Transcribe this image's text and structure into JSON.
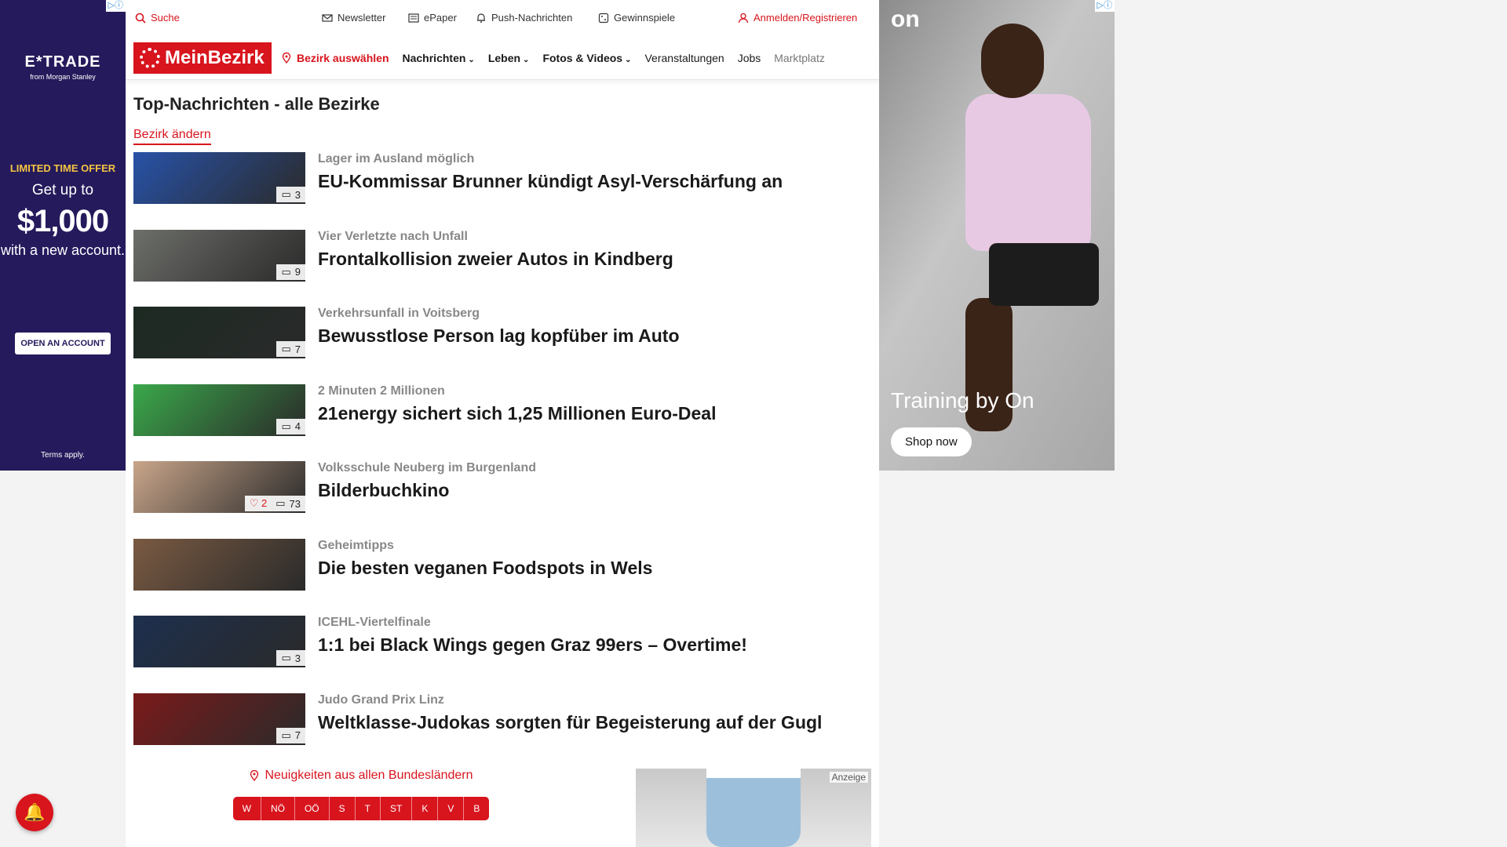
{
  "ad_left": {
    "adchoice": "▷ⓘ",
    "logo": "E*TRADE",
    "logo_sub": "from Morgan Stanley",
    "offer": "LIMITED TIME OFFER",
    "get_up_to": "Get up to",
    "amount": "$1,000",
    "with_new": "with a new account.",
    "button": "OPEN AN ACCOUNT",
    "terms": "Terms apply."
  },
  "topbar": {
    "search": "Suche",
    "newsletter": "Newsletter",
    "epaper": "ePaper",
    "push": "Push-Nachrichten",
    "gewinnspiele": "Gewinnspiele",
    "login": "Anmelden/Registrieren"
  },
  "nav": {
    "brand": "MeinBezirk",
    "select_district": "Bezirk auswählen",
    "items": [
      {
        "label": "Nachrichten",
        "dropdown": true
      },
      {
        "label": "Leben",
        "dropdown": true
      },
      {
        "label": "Fotos & Videos",
        "dropdown": true
      },
      {
        "label": "Veranstaltungen",
        "dropdown": false
      },
      {
        "label": "Jobs",
        "dropdown": false
      },
      {
        "label": "Marktplatz",
        "dropdown": false
      }
    ]
  },
  "page": {
    "title": "Top-Nachrichten - alle Bezirke",
    "change_district": "Bezirk ändern"
  },
  "articles": [
    {
      "kicker": "Lager im Ausland möglich",
      "headline": "EU-Kommissar Brunner kündigt Asyl-Verschärfung an",
      "photos": "3",
      "likes": "",
      "thumb_color": "#2852a8"
    },
    {
      "kicker": "Vier Verletzte nach Unfall",
      "headline": "Frontalkollision zweier Autos in Kindberg",
      "photos": "9",
      "likes": "",
      "thumb_color": "#6d6f6a"
    },
    {
      "kicker": "Verkehrsunfall in Voitsberg",
      "headline": "Bewusstlose Person lag kopfüber im Auto",
      "photos": "7",
      "likes": "",
      "thumb_color": "#1c2a22"
    },
    {
      "kicker": "2 Minuten 2 Millionen",
      "headline": "21energy sichert sich 1,25 Millionen Euro-Deal",
      "photos": "4",
      "likes": "",
      "thumb_color": "#3aa84a"
    },
    {
      "kicker": "Volksschule Neuberg im Burgenland",
      "headline": "Bilderbuchkino",
      "photos": "73",
      "likes": "2",
      "thumb_color": "#c9a58a"
    },
    {
      "kicker": "Geheimtipps",
      "headline": "Die besten veganen Foodspots in Wels",
      "photos": "",
      "likes": "",
      "thumb_color": "#7a5a42"
    },
    {
      "kicker": "ICEHL-Viertelfinale",
      "headline": "1:1 bei Black Wings gegen Graz 99ers – Overtime!",
      "photos": "3",
      "likes": "",
      "thumb_color": "#1d2f4e"
    },
    {
      "kicker": "Judo Grand Prix Linz",
      "headline": "Weltklasse-Judokas sorgten für Begeisterung auf der Gugl",
      "photos": "7",
      "likes": "",
      "thumb_color": "#7a1a1a"
    }
  ],
  "regions": {
    "title": "Neuigkeiten aus allen Bundesländern",
    "buttons": [
      "W",
      "NÖ",
      "OÖ",
      "S",
      "T",
      "ST",
      "K",
      "V",
      "B"
    ]
  },
  "ad_small": {
    "label": "Anzeige"
  },
  "ad_right": {
    "adchoice": "▷ⓘ",
    "logo": "on",
    "tagline": "Training by On",
    "button": "Shop now"
  },
  "colors": {
    "brand_red": "#d8141d",
    "etrade_bg": "#251a5c"
  }
}
